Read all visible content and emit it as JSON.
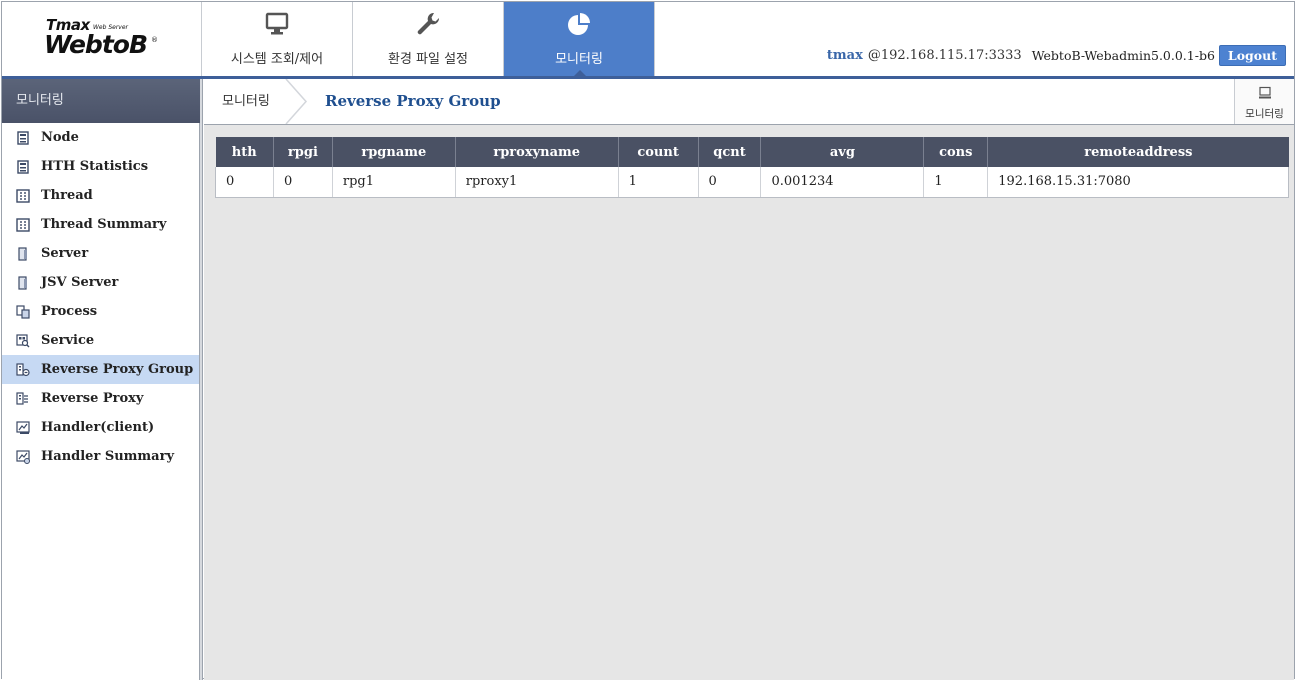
{
  "logo": {
    "tmax": "Tmax",
    "web_server": "Web Server",
    "webtob": "WebtoB",
    "reg": "®"
  },
  "nav": {
    "tabs": [
      {
        "label": "시스템 조회/제어",
        "icon": "monitor-icon"
      },
      {
        "label": "환경 파일 설정",
        "icon": "wrench-icon"
      },
      {
        "label": "모니터링",
        "icon": "pie-chart-icon",
        "active": true
      }
    ]
  },
  "user": {
    "name": "tmax",
    "host": "@192.168.115.17:3333",
    "version": "WebtoB-Webadmin5.0.0.1-b6",
    "logout_label": "Logout"
  },
  "sidebar": {
    "title": "모니터링",
    "items": [
      {
        "label": "Node",
        "icon": "node-icon"
      },
      {
        "label": "HTH Statistics",
        "icon": "hth-statistics-icon"
      },
      {
        "label": "Thread",
        "icon": "thread-icon"
      },
      {
        "label": "Thread Summary",
        "icon": "thread-summary-icon"
      },
      {
        "label": "Server",
        "icon": "server-icon"
      },
      {
        "label": "JSV Server",
        "icon": "jsv-server-icon"
      },
      {
        "label": "Process",
        "icon": "process-icon"
      },
      {
        "label": "Service",
        "icon": "service-icon"
      },
      {
        "label": "Reverse Proxy Group",
        "icon": "reverse-proxy-group-icon",
        "active": true
      },
      {
        "label": "Reverse Proxy",
        "icon": "reverse-proxy-icon"
      },
      {
        "label": "Handler(client)",
        "icon": "handler-client-icon"
      },
      {
        "label": "Handler Summary",
        "icon": "handler-summary-icon"
      }
    ]
  },
  "breadcrumb": {
    "root": "모니터링",
    "current": "Reverse Proxy Group"
  },
  "shortcut": {
    "label": "모니터링",
    "icon": "monitor-icon"
  },
  "table": {
    "columns": [
      "hth",
      "rpgi",
      "rpgname",
      "rproxyname",
      "count",
      "qcnt",
      "avg",
      "cons",
      "remoteaddress"
    ],
    "rows": [
      [
        "0",
        "0",
        "rpg1",
        "rproxy1",
        "1",
        "0",
        "0.001234",
        "1",
        "192.168.15.31:7080"
      ]
    ]
  },
  "colors": {
    "accent": "#4d7ec9",
    "header_line": "#3e5f99",
    "sidebar_header": "#525a6f",
    "table_header": "#4a5164",
    "active_item": "#c6d9f3",
    "content_bg": "#e6e6e6"
  }
}
